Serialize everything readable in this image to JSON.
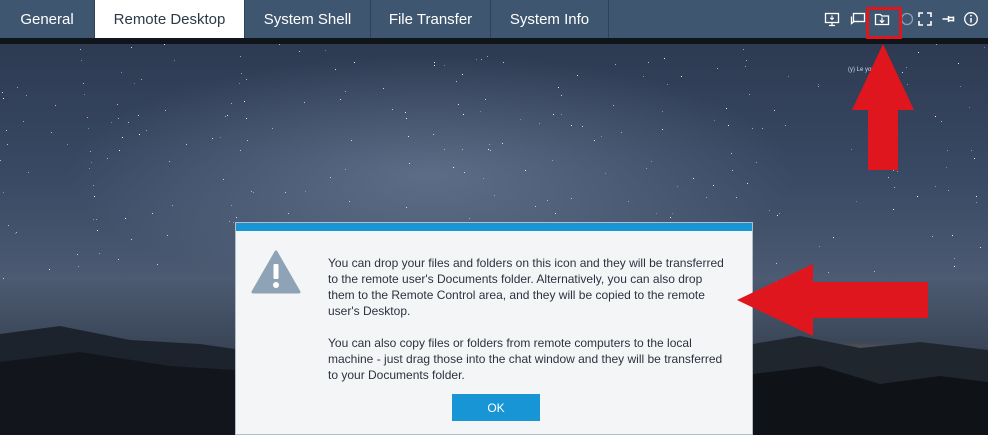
{
  "tabs": [
    {
      "label": "General",
      "active": false
    },
    {
      "label": "Remote Desktop",
      "active": true
    },
    {
      "label": "System Shell",
      "active": false
    },
    {
      "label": "File Transfer",
      "active": false
    },
    {
      "label": "System Info",
      "active": false
    }
  ],
  "toolbar_icons": [
    "monitor-icon",
    "chat-icon",
    "file-transfer-icon",
    "circle-icon",
    "fullscreen-icon",
    "pin-icon",
    "info-icon"
  ],
  "remote_desktop": {
    "overlay_text": "(y)      Le            you see?"
  },
  "dialog": {
    "paragraph1": "You can drop your files and folders on this icon and they will be transferred to the remote user's Documents folder. Alternatively, you can also drop them to the Remote Control area, and they will be copied to the remote user's Desktop.",
    "paragraph2": "You can also copy files or folders from remote computers to the local machine - just drag those into the chat window and they will be transferred to your Documents folder.",
    "ok_label": "OK"
  },
  "colors": {
    "tab_bar": "#3f5670",
    "accent": "#1795d4",
    "annotation": "#e0161e"
  }
}
